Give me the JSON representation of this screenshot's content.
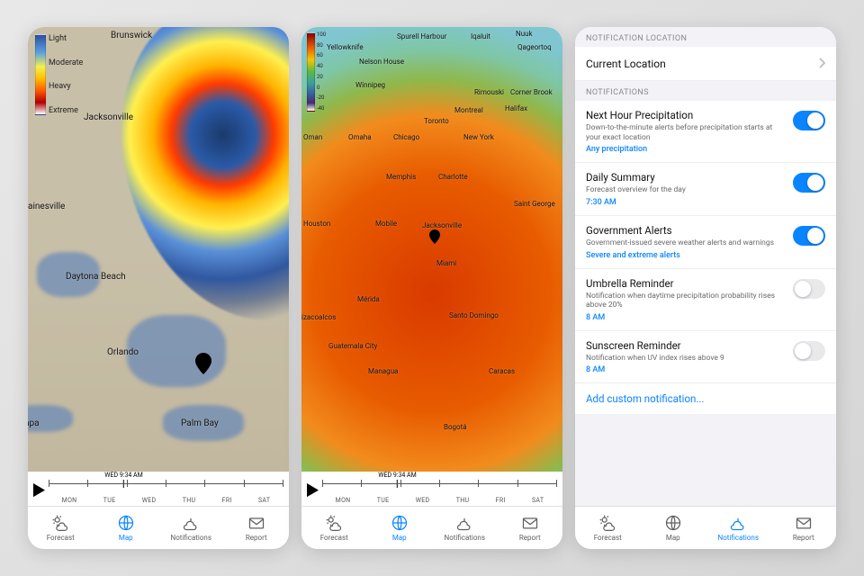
{
  "timeline": {
    "current_label": "WED  9:34 AM",
    "days": [
      "MON",
      "TUE",
      "WED",
      "THU",
      "FRI",
      "SAT"
    ]
  },
  "tabbar": {
    "forecast": "Forecast",
    "map": "Map",
    "notifications": "Notifications",
    "report": "Report"
  },
  "screen1": {
    "legend": {
      "light": "Light",
      "moderate": "Moderate",
      "heavy": "Heavy",
      "extreme": "Extreme"
    },
    "cities": {
      "brunswick": "Brunswick",
      "jacksonville": "Jacksonville",
      "gainesville": "ainesville",
      "daytona": "Daytona Beach",
      "orlando": "Orlando",
      "palmbay": "Palm Bay",
      "tampa": "npa"
    }
  },
  "screen2": {
    "legend_ticks": [
      "100",
      "80",
      "60",
      "40",
      "20",
      "0",
      "-20",
      "-40"
    ],
    "cities": {
      "yellowknife": "Yellowknife",
      "spurell": "Spurell Harbour",
      "iqaluit": "Iqaluit",
      "nuuk": "Nuuk",
      "qageortoq": "Qageortoq",
      "nelson": "Nelson House",
      "winnipeg": "Winnipeg",
      "rimouski": "Rimouski",
      "cornerbrook": "Corner Brook",
      "montreal": "Montreal",
      "toronto": "Toronto",
      "halifax": "Halifax",
      "chicago": "Chicago",
      "newyork": "New York",
      "omaha": "Omaha",
      "oman": "Oman",
      "memphis": "Memphis",
      "charlotte": "Charlotte",
      "saintgeorge": "Saint George",
      "houston": "Houston",
      "mobile": "Mobile",
      "jacksonville": "Jacksonville",
      "miami": "Miami",
      "merida": "Mérida",
      "izacoalcos": "izacoalcos",
      "santodomingo": "Santo Domingo",
      "guatemala": "Guatemala City",
      "managua": "Managua",
      "caracas": "Caracas",
      "bogota": "Bogotá"
    }
  },
  "settings": {
    "section_location": "NOTIFICATION LOCATION",
    "current_location": "Current Location",
    "section_notifications": "NOTIFICATIONS",
    "add_custom": "Add custom notification...",
    "items": {
      "precip": {
        "title": "Next Hour Precipitation",
        "desc": "Down-to-the-minute alerts before precipitation starts at your exact location",
        "detail": "Any precipitation",
        "on": true
      },
      "daily": {
        "title": "Daily Summary",
        "desc": "Forecast overview for the day",
        "detail": "7:30 AM",
        "on": true
      },
      "gov": {
        "title": "Government Alerts",
        "desc": "Government-issued severe weather alerts and warnings",
        "detail": "Severe and extreme alerts",
        "on": true
      },
      "umbrella": {
        "title": "Umbrella Reminder",
        "desc": "Notification when daytime precipitation probability rises above 20%",
        "detail": "8 AM",
        "on": false
      },
      "sunscreen": {
        "title": "Sunscreen Reminder",
        "desc": "Notification when UV index rises above 9",
        "detail": "8 AM",
        "on": false
      }
    }
  }
}
